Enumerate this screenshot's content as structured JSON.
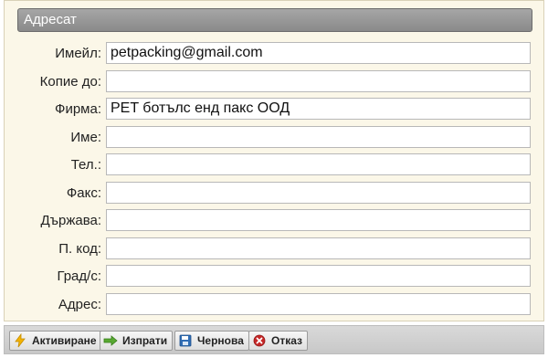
{
  "panel": {
    "title": "Адресат"
  },
  "fields": [
    {
      "label": "Имейл:",
      "value": "petpacking@gmail.com"
    },
    {
      "label": "Копие до:",
      "value": ""
    },
    {
      "label": "Фирма:",
      "value": "PET ботълс енд пакс ООД"
    },
    {
      "label": "Име:",
      "value": ""
    },
    {
      "label": "Тел.:",
      "value": ""
    },
    {
      "label": "Факс:",
      "value": ""
    },
    {
      "label": "Държава:",
      "value": ""
    },
    {
      "label": "П. код:",
      "value": ""
    },
    {
      "label": "Град/с:",
      "value": ""
    },
    {
      "label": "Адрес:",
      "value": ""
    }
  ],
  "toolbar": {
    "activate_label": "Активиране",
    "send_label": "Изпрати",
    "draft_label": "Чернова",
    "cancel_label": "Отказ"
  },
  "icons": {
    "activate": "lightning-icon",
    "send": "arrow-right-icon",
    "draft": "floppy-disk-icon",
    "cancel": "close-circle-icon"
  },
  "colors": {
    "panel_bg": "#fbf7e8",
    "header_bg": "#9a9a9a",
    "toolbar_bg": "#d0d0d0",
    "activate_icon": "#f3b300",
    "send_icon": "#58a832",
    "draft_icon": "#2f6db5",
    "cancel_icon": "#c62828"
  }
}
